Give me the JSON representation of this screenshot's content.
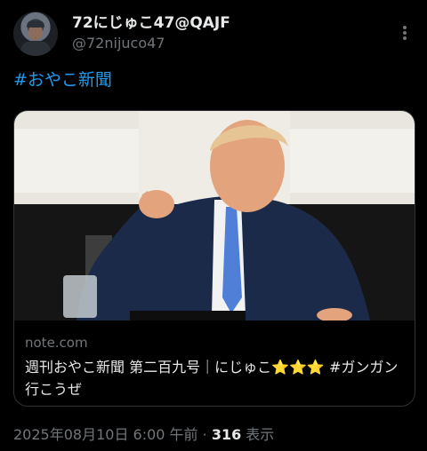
{
  "tweet": {
    "display_name": "72にじゅこ47@QAJF",
    "handle": "@72nijuco47",
    "text_hashtag": "#おやこ新聞",
    "card": {
      "domain": "note.com",
      "title": "週刊おやこ新聞 第二百九号｜にじゅこ⭐⭐⭐ #ガンガン行こうぜ"
    },
    "timestamp": "2025年08月10日 6:00 午前",
    "separator": " · ",
    "views_count": "316",
    "views_label": " 表示"
  },
  "icons": {
    "more": "more-dots-icon"
  },
  "colors": {
    "background": "#000000",
    "text": "#e7e9ea",
    "secondary": "#71767b",
    "link": "#1d9bf0",
    "border": "#2f3336"
  }
}
